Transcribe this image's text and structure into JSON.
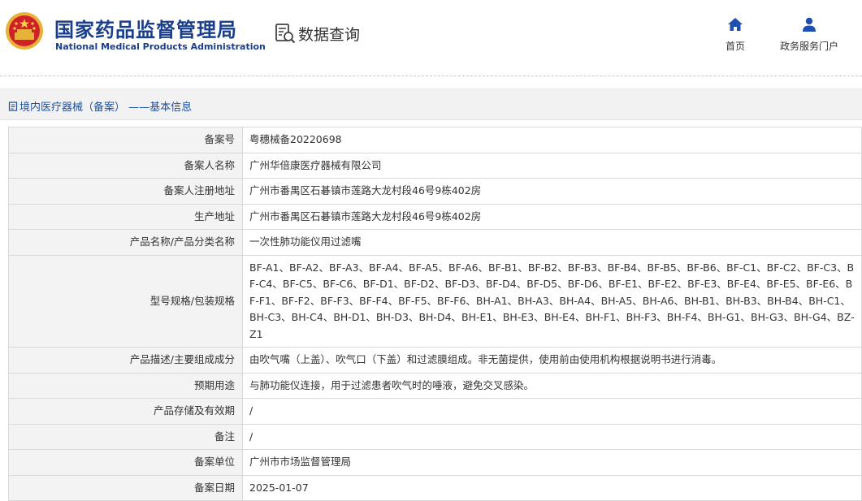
{
  "header": {
    "brand_cn": "国家药品监督管理局",
    "brand_en": "National Medical Products Administration",
    "section_title": "数据查询",
    "nav": {
      "home": "首页",
      "gov_service": "政务服务门户"
    },
    "brand_color": "#1a3e8c"
  },
  "breadcrumb": "境内医疗器械（备案） ——基本信息",
  "record": [
    {
      "label": "备案号",
      "value": "粤穗械备20220698"
    },
    {
      "label": "备案人名称",
      "value": "广州华倍康医疗器械有限公司"
    },
    {
      "label": "备案人注册地址",
      "value": "广州市番禺区石碁镇市莲路大龙村段46号9栋402房"
    },
    {
      "label": "生产地址",
      "value": "广州市番禺区石碁镇市莲路大龙村段46号9栋402房"
    },
    {
      "label": "产品名称/产品分类名称",
      "value": "一次性肺功能仪用过滤嘴"
    },
    {
      "label": "型号规格/包装规格",
      "value": "BF-A1、BF-A2、BF-A3、BF-A4、BF-A5、BF-A6、BF-B1、BF-B2、BF-B3、BF-B4、BF-B5、BF-B6、BF-C1、BF-C2、BF-C3、BF-C4、BF-C5、BF-C6、BF-D1、BF-D2、BF-D3、BF-D4、BF-D5、BF-D6、BF-E1、BF-E2、BF-E3、BF-E4、BF-E5、BF-E6、BF-F1、BF-F2、BF-F3、BF-F4、BF-F5、BF-F6、BH-A1、BH-A3、BH-A4、BH-A5、BH-A6、BH-B1、BH-B3、BH-B4、BH-C1、BH-C3、BH-C4、BH-D1、BH-D3、BH-D4、BH-E1、BH-E3、BH-E4、BH-F1、BH-F3、BH-F4、BH-G1、BH-G3、BH-G4、BZ-Z1"
    },
    {
      "label": "产品描述/主要组成成分",
      "value": "由吹气嘴（上盖）、吹气口（下盖）和过滤膜组成。非无菌提供，使用前由使用机构根据说明书进行消毒。"
    },
    {
      "label": "预期用途",
      "value": "与肺功能仪连接，用于过滤患者吹气时的唾液，避免交叉感染。"
    },
    {
      "label": "产品存储及有效期",
      "value": "/"
    },
    {
      "label": "备注",
      "value": "/"
    },
    {
      "label": "备案单位",
      "value": "广州市市场监督管理局"
    },
    {
      "label": "备案日期",
      "value": "2025-01-07"
    }
  ]
}
